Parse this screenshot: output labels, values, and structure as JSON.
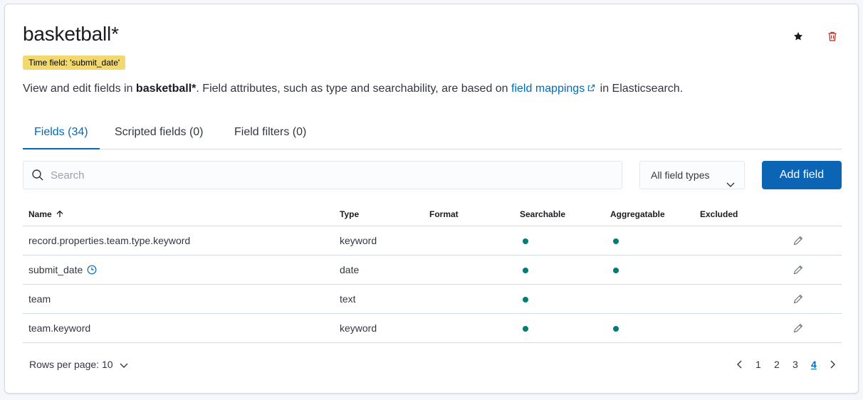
{
  "header": {
    "title": "basketball*",
    "badge": "Time field: 'submit_date'"
  },
  "description": {
    "prefix": "View and edit fields in ",
    "pattern": "basketball*",
    "middle": ". Field attributes, such as type and searchability, are based on ",
    "link": "field mappings",
    "suffix": " in Elasticsearch."
  },
  "tabs": [
    {
      "label": "Fields (34)",
      "active": true
    },
    {
      "label": "Scripted fields (0)",
      "active": false
    },
    {
      "label": "Field filters (0)",
      "active": false
    }
  ],
  "search": {
    "placeholder": "Search"
  },
  "filter": {
    "selected": "All field types"
  },
  "add_button": "Add field",
  "table": {
    "columns": [
      "Name",
      "Type",
      "Format",
      "Searchable",
      "Aggregatable",
      "Excluded"
    ],
    "rows": [
      {
        "name": "record.properties.team.type.keyword",
        "type": "keyword",
        "format": "",
        "searchable": true,
        "aggregatable": true,
        "excluded": false,
        "time_field": false
      },
      {
        "name": "submit_date",
        "type": "date",
        "format": "",
        "searchable": true,
        "aggregatable": true,
        "excluded": false,
        "time_field": true
      },
      {
        "name": "team",
        "type": "text",
        "format": "",
        "searchable": true,
        "aggregatable": false,
        "excluded": false,
        "time_field": false
      },
      {
        "name": "team.keyword",
        "type": "keyword",
        "format": "",
        "searchable": true,
        "aggregatable": true,
        "excluded": false,
        "time_field": false
      }
    ]
  },
  "pagination": {
    "rows_per_page": "Rows per page: 10",
    "pages": [
      "1",
      "2",
      "3",
      "4"
    ],
    "current": "4"
  },
  "colors": {
    "accent": "#006bb8",
    "button": "#0b64b4",
    "badge": "#f1d86f",
    "dot": "#017d73",
    "trash": "#bd271e"
  },
  "icons": [
    "star-icon",
    "trash-icon",
    "external-link-icon",
    "search-icon",
    "chevron-down-icon",
    "sort-arrow-up-icon",
    "clock-icon",
    "pencil-icon",
    "chevron-left-icon",
    "chevron-right-icon"
  ]
}
